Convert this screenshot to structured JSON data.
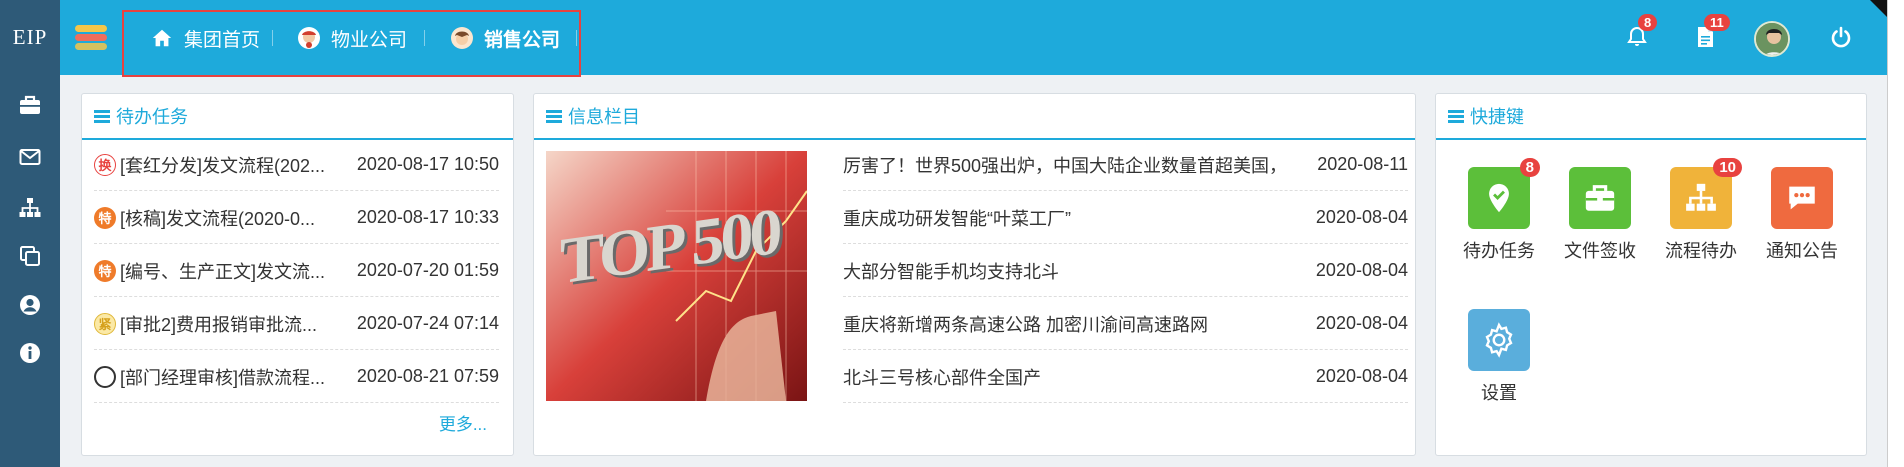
{
  "app": {
    "logo": "EIP"
  },
  "sidebar": {
    "items": [
      {
        "icon": "briefcase-icon"
      },
      {
        "icon": "mail-icon"
      },
      {
        "icon": "org-chart-icon"
      },
      {
        "icon": "copy-icon"
      },
      {
        "icon": "user-circle-icon"
      },
      {
        "icon": "info-icon"
      }
    ]
  },
  "header": {
    "tabs": [
      {
        "label": "集团首页",
        "icon": "home-icon"
      },
      {
        "label": "物业公司",
        "icon": "avatar-icon"
      },
      {
        "label": "销售公司",
        "icon": "avatar-icon",
        "active": true
      }
    ],
    "notifications_count": "8",
    "documents_count": "11"
  },
  "tasks": {
    "title": "待办任务",
    "items": [
      {
        "tag": "换",
        "title": "[套红分发]发文流程(202...",
        "date": "2020-08-17 10:50"
      },
      {
        "tag": "特",
        "title": "[核稿]发文流程(2020-0...",
        "date": "2020-08-17 10:33"
      },
      {
        "tag": "特",
        "title": "[编号、生产正文]发文流...",
        "date": "2020-07-20 01:59"
      },
      {
        "tag": "紧",
        "title": "[审批2]费用报销审批流...",
        "date": "2020-07-24 07:14"
      },
      {
        "tag": "",
        "title": "[部门经理审核]借款流程...",
        "date": "2020-08-21 07:59"
      }
    ],
    "more": "更多..."
  },
  "news": {
    "title": "信息栏目",
    "image_text": "TOP 500",
    "items": [
      {
        "title": "厉害了！世界500强出炉，中国大陆企业数量首超美国，...",
        "date": "2020-08-11"
      },
      {
        "title": "重庆成功研发智能“叶菜工厂”",
        "date": "2020-08-04"
      },
      {
        "title": "大部分智能手机均支持北斗",
        "date": "2020-08-04"
      },
      {
        "title": "重庆将新增两条高速公路 加密川渝间高速路网",
        "date": "2020-08-04"
      },
      {
        "title": "北斗三号核心部件全国产",
        "date": "2020-08-04"
      }
    ]
  },
  "shortcuts": {
    "title": "快捷键",
    "items": [
      {
        "label": "待办任务",
        "badge": "8",
        "color": "#5cbf3a",
        "icon": "location-check-icon"
      },
      {
        "label": "文件签收",
        "badge": "",
        "color": "#5cbf3a",
        "icon": "briefcase-icon"
      },
      {
        "label": "流程待办",
        "badge": "10",
        "color": "#f0b33a",
        "icon": "org-chart-icon"
      },
      {
        "label": "通知公告",
        "badge": "",
        "color": "#ef6a3f",
        "icon": "chat-icon"
      },
      {
        "label": "设置",
        "badge": "",
        "color": "#5aaedc",
        "icon": "gear-icon"
      }
    ]
  }
}
